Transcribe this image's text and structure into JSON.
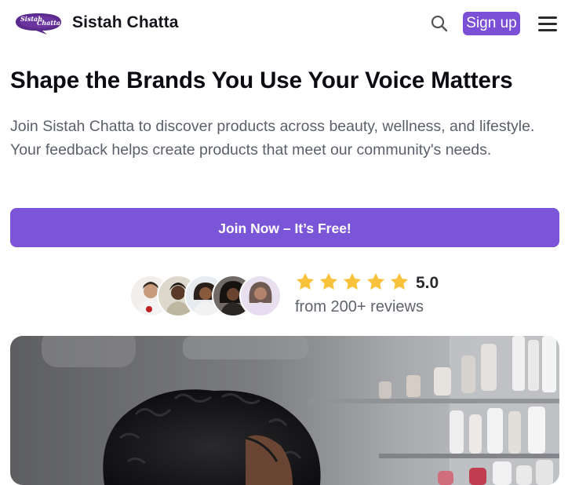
{
  "header": {
    "logo_text_1": "Sistah",
    "logo_text_2": "Chatta",
    "brand": "Sistah Chatta",
    "signup_label": "Sign up"
  },
  "hero": {
    "title": "Shape the Brands You Use Your Voice Matters",
    "description": "Join Sistah Chatta to discover products across beauty, wellness, and lifestyle. Your feedback helps create products that meet our community's needs.",
    "cta_label": "Join Now – It’s Free!"
  },
  "social_proof": {
    "avatar_count": 5,
    "stars": 5,
    "rating": "5.0",
    "reviews_text": "from 200+ reviews"
  },
  "colors": {
    "accent": "#7b55d8",
    "star": "#f8c23a",
    "text": "#0b0b12",
    "muted": "#5a5f6a"
  },
  "icons": {
    "search": "search-icon",
    "menu": "hamburger-menu-icon",
    "star": "star-icon"
  }
}
